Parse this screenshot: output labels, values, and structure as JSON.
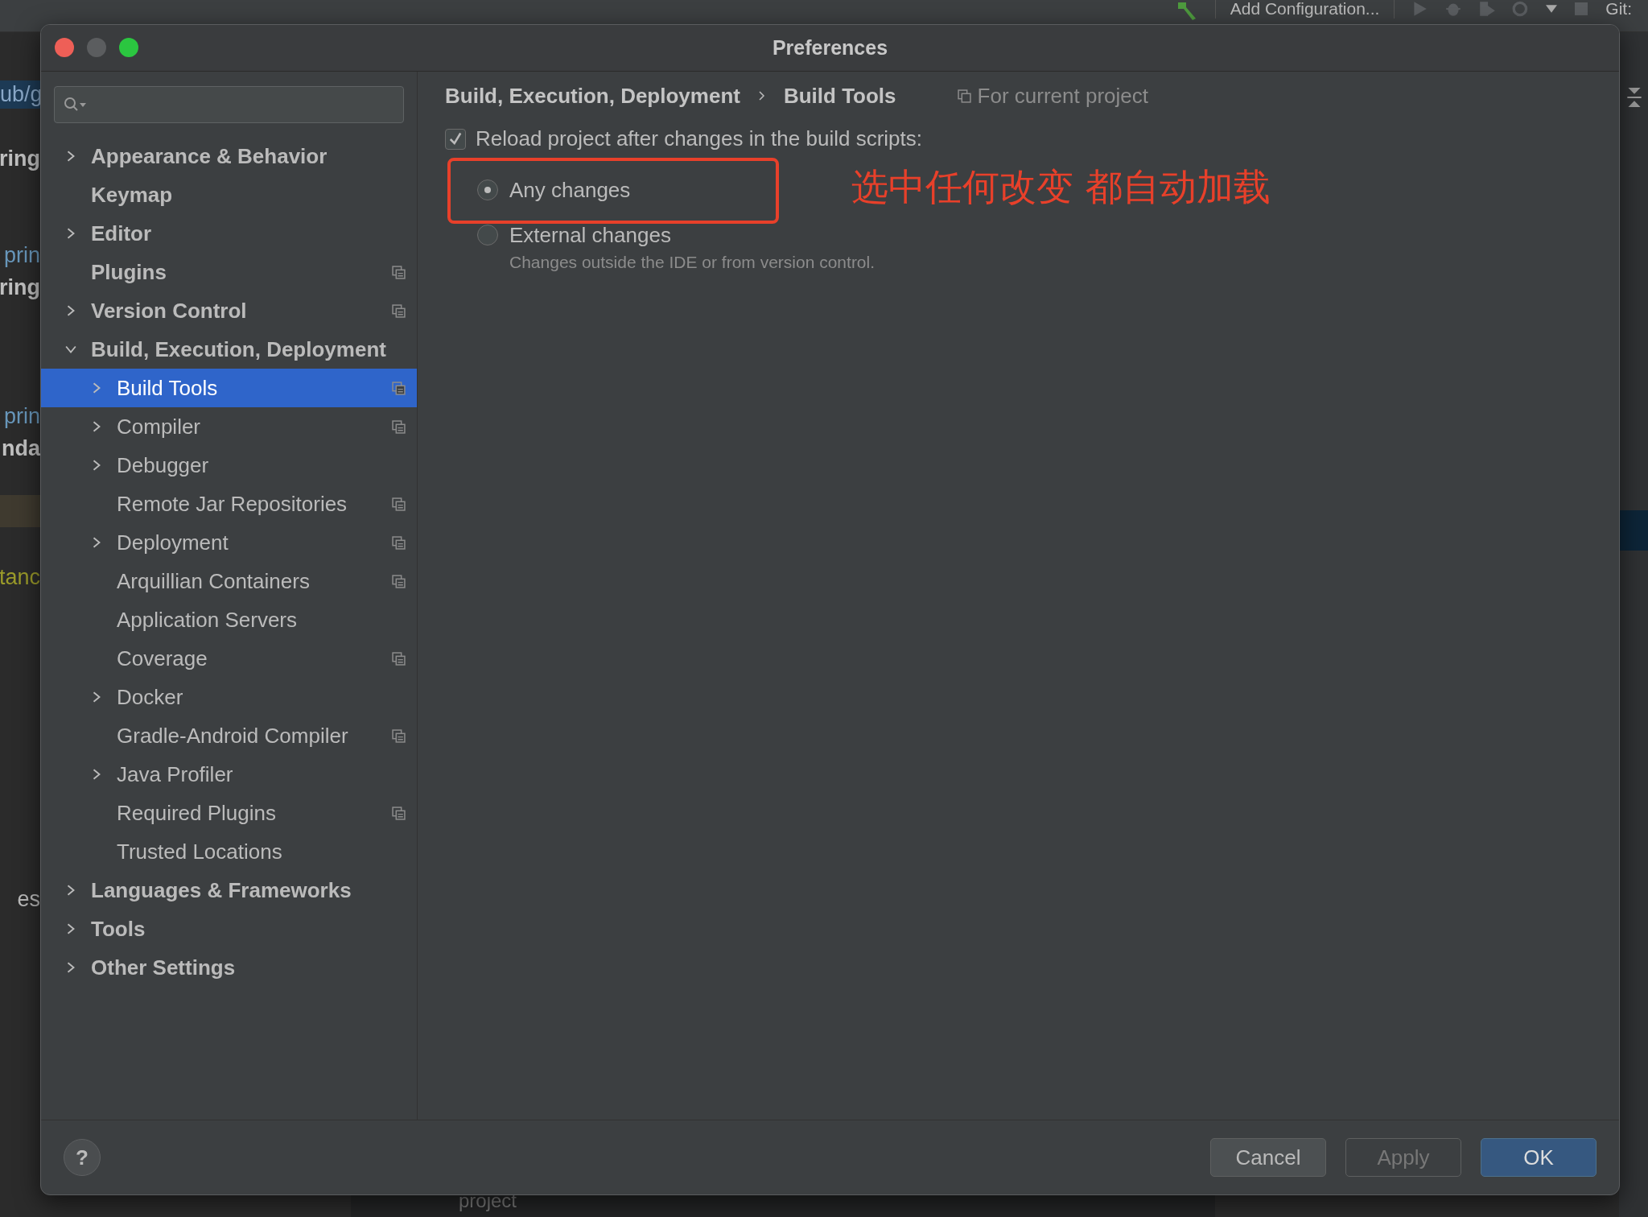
{
  "ide_toolbar": {
    "run_config": "Add Configuration...",
    "git_label": "Git:"
  },
  "ide_background": {
    "left_fragments": [
      {
        "text": "ub/g",
        "kind": "path"
      },
      {
        "text": "ring",
        "kind": "bold"
      },
      {
        "text": "prin",
        "kind": "link"
      },
      {
        "text": "ring",
        "kind": "bold"
      },
      {
        "text": "prin",
        "kind": "link"
      },
      {
        "text": "nda",
        "kind": "bold"
      },
      {
        "text": "tanc",
        "kind": "warning"
      },
      {
        "text": "es",
        "kind": "plain"
      }
    ],
    "bottom_fragment": "project"
  },
  "dialog": {
    "title": "Preferences",
    "tree": [
      {
        "label": "Appearance & Behavior",
        "kind": "group",
        "expanded": false,
        "selected": false,
        "project_level": false
      },
      {
        "label": "Keymap",
        "kind": "page",
        "expanded": false,
        "selected": false,
        "project_level": false
      },
      {
        "label": "Editor",
        "kind": "group",
        "expanded": false,
        "selected": false,
        "project_level": false
      },
      {
        "label": "Plugins",
        "kind": "page",
        "expanded": false,
        "selected": false,
        "project_level": true
      },
      {
        "label": "Version Control",
        "kind": "group",
        "expanded": false,
        "selected": false,
        "project_level": true
      },
      {
        "label": "Build, Execution, Deployment",
        "kind": "group",
        "expanded": true,
        "selected": false,
        "project_level": false,
        "children": [
          {
            "label": "Build Tools",
            "kind": "group",
            "expanded": false,
            "selected": true,
            "project_level": true
          },
          {
            "label": "Compiler",
            "kind": "group",
            "expanded": false,
            "selected": false,
            "project_level": true
          },
          {
            "label": "Debugger",
            "kind": "group",
            "expanded": false,
            "selected": false,
            "project_level": false
          },
          {
            "label": "Remote Jar Repositories",
            "kind": "page",
            "expanded": false,
            "selected": false,
            "project_level": true
          },
          {
            "label": "Deployment",
            "kind": "group",
            "expanded": false,
            "selected": false,
            "project_level": true
          },
          {
            "label": "Arquillian Containers",
            "kind": "page",
            "expanded": false,
            "selected": false,
            "project_level": true
          },
          {
            "label": "Application Servers",
            "kind": "page",
            "expanded": false,
            "selected": false,
            "project_level": false
          },
          {
            "label": "Coverage",
            "kind": "page",
            "expanded": false,
            "selected": false,
            "project_level": true
          },
          {
            "label": "Docker",
            "kind": "group",
            "expanded": false,
            "selected": false,
            "project_level": false
          },
          {
            "label": "Gradle-Android Compiler",
            "kind": "page",
            "expanded": false,
            "selected": false,
            "project_level": true
          },
          {
            "label": "Java Profiler",
            "kind": "group",
            "expanded": false,
            "selected": false,
            "project_level": false
          },
          {
            "label": "Required Plugins",
            "kind": "page",
            "expanded": false,
            "selected": false,
            "project_level": true
          },
          {
            "label": "Trusted Locations",
            "kind": "page",
            "expanded": false,
            "selected": false,
            "project_level": false
          }
        ]
      },
      {
        "label": "Languages & Frameworks",
        "kind": "group",
        "expanded": false,
        "selected": false,
        "project_level": false
      },
      {
        "label": "Tools",
        "kind": "group",
        "expanded": false,
        "selected": false,
        "project_level": false
      },
      {
        "label": "Other Settings",
        "kind": "group",
        "expanded": false,
        "selected": false,
        "project_level": false
      }
    ],
    "breadcrumb": [
      "Build, Execution, Deployment",
      "Build Tools"
    ],
    "scope_note": "For current project",
    "reload_checkbox": {
      "label": "Reload project after changes in the build scripts:",
      "checked": true
    },
    "options": [
      {
        "label": "Any changes",
        "selected": true,
        "highlighted": true
      },
      {
        "label": "External changes",
        "selected": false,
        "highlighted": false
      }
    ],
    "hint": "Changes outside the IDE or from version control.",
    "annotation": "选中任何改变 都自动加载",
    "help": "?",
    "buttons": [
      {
        "label": "Cancel",
        "kind": "normal"
      },
      {
        "label": "Apply",
        "kind": "disabled"
      },
      {
        "label": "OK",
        "kind": "default"
      }
    ]
  }
}
